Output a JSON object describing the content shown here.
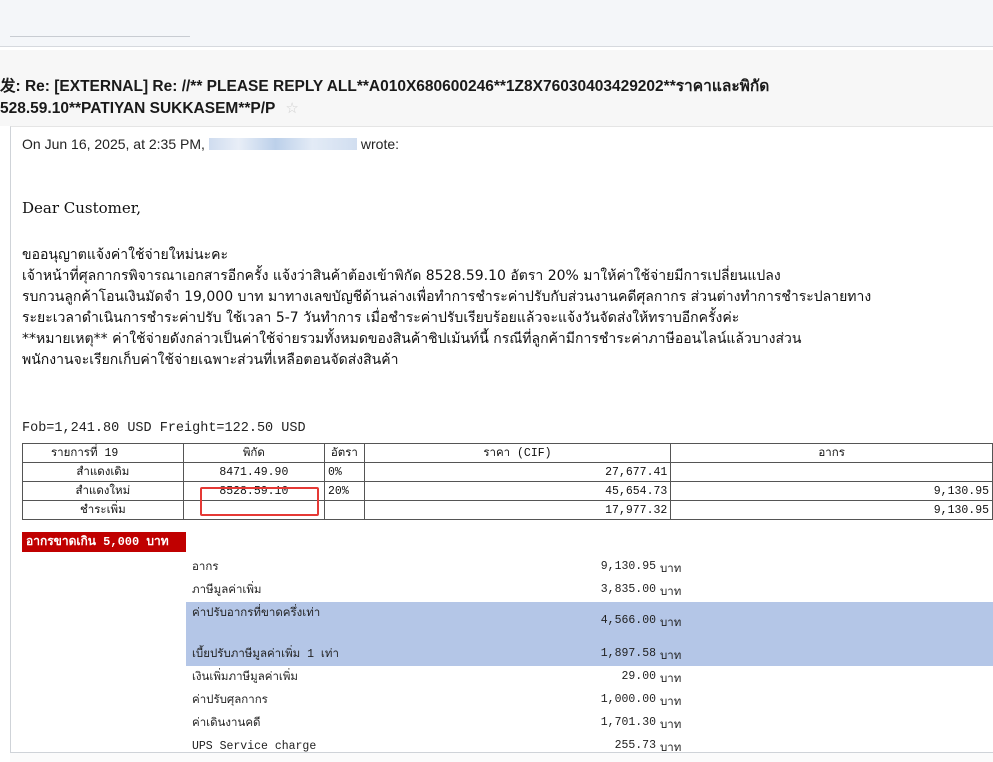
{
  "subject": {
    "line1": "发: Re: [EXTERNAL] Re: //** PLEASE REPLY ALL**A010X680600246**1Z8X76030403429202**ราคาและพิกัด",
    "line2": "528.59.10**PATIYAN SUKKASEM**P/P",
    "star_icon": "☆"
  },
  "quote_header": {
    "prefix": "On Jun 16, 2025, at 2:35 PM,",
    "suffix": "wrote:"
  },
  "greeting": "Dear Customer,",
  "paragraphs": [
    "ขออนุญาตแจ้งค่าใช้จ่ายใหม่นะคะ",
    "เจ้าหน้าที่ศุลกากรพิจารณาเอกสารอีกครั้ง แจ้งว่าสินค้าต้องเข้าพิกัด 8528.59.10 อัตรา 20%    มาให้ค่าใช้จ่ายมีการเปลี่ยนแปลง",
    "รบกวนลูกค้าโอนเงินมัดจำ 19,000 บาท มาทางเลขบัญชีด้านล่างเพื่อทำการชำระค่าปรับกับส่วนงานคดีศุลกากร ส่วนต่างทำการชำระปลายทาง",
    "ระยะเวลาดำเนินการชำระค่าปรับ ใช้เวลา 5-7 วันทำการ เมื่อชำระค่าปรับเรียบร้อยแล้วจะแจ้งวันจัดส่งให้ทราบอีกครั้งค่ะ",
    "**หมายเหตุ** ค่าใช้จ่ายดังกล่าวเป็นค่าใช้จ่ายรวมทั้งหมดของสินค้าชิปเม้นท์นี้ กรณีที่ลูกค้ามีการชำระค่าภาษีออนไลน์แล้วบางส่วน",
    "พนักงานจะเรียกเก็บค่าใช้จ่ายเฉพาะส่วนที่เหลือตอนจัดส่งสินค้า"
  ],
  "fob_line": "Fob=1,241.80 USD Freight=122.50 USD",
  "rate_table": {
    "header": [
      "รายการที่    19",
      "พิกัด",
      "อัตรา",
      "ราคา (CIF)",
      "อากร"
    ],
    "rows": [
      [
        "สำแดงเดิม",
        "8471.49.90",
        "0%",
        "27,677.41",
        ""
      ],
      [
        "สำแดงใหม่",
        "8528.59.10",
        "20%",
        "45,654.73",
        "9,130.95"
      ],
      [
        "ชำระเพิ่ม",
        "",
        "",
        "17,977.32",
        "9,130.95"
      ]
    ]
  },
  "alert_label": "อากรขาดเกิน 5,000 บาท",
  "summary": [
    {
      "label": "อากร",
      "amount": "9,130.95",
      "unit": "บาท"
    },
    {
      "label": "ภาษีมูลค่าเพิ่ม",
      "amount": "3,835.00",
      "unit": "บาท"
    },
    {
      "label": "ค่าปรับอากรที่ขาดครึ่งเท่า",
      "amount": "4,566.00",
      "unit": "บาท"
    },
    {
      "label": "เบี้ยปรับภาษีมูลค่าเพิ่ม 1 เท่า",
      "amount": "1,897.58",
      "unit": "บาท"
    },
    {
      "label": "เงินเพิ่มภาษีมูลค่าเพิ่ม",
      "amount": "29.00",
      "unit": "บาท"
    },
    {
      "label": "ค่าปรับศุลกากร",
      "amount": "1,000.00",
      "unit": "บาท"
    },
    {
      "label": "ค่าเดินงานคดี",
      "amount": "1,701.30",
      "unit": "บาท"
    },
    {
      "label": "UPS Service charge",
      "amount": "255.73",
      "unit": "บาท"
    }
  ],
  "colors": {
    "highlight_box": "#e53935",
    "alert_bg": "#c00000",
    "summary_highlight": "#b4c6e7"
  }
}
